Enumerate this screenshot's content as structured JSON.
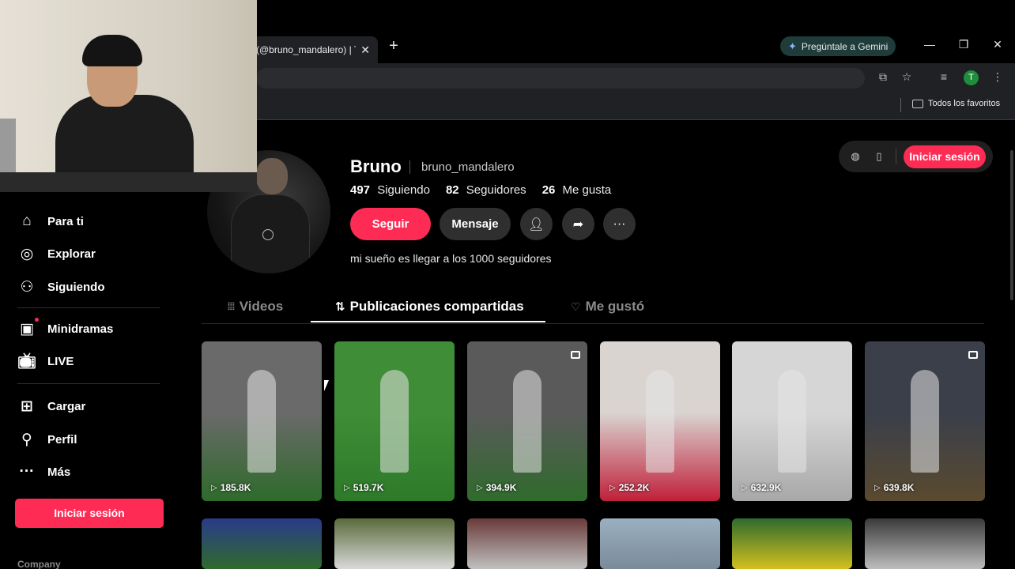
{
  "browser": {
    "tab_title": "(@bruno_mandalero) | Ti",
    "tab_close": "✕",
    "new_tab": "+",
    "gemini_label": "Pregúntale a Gemini",
    "profile_initial": "T",
    "bookmarks_label": "Todos los favoritos"
  },
  "sidebar": {
    "items": [
      {
        "label": "Para ti",
        "icon": "home-icon"
      },
      {
        "label": "Explorar",
        "icon": "compass-icon"
      },
      {
        "label": "Siguiendo",
        "icon": "following-icon"
      },
      {
        "label": "Minidramas",
        "icon": "minidrama-icon"
      },
      {
        "label": "LIVE",
        "icon": "live-icon"
      },
      {
        "label": "Cargar",
        "icon": "upload-icon"
      },
      {
        "label": "Perfil",
        "icon": "profile-icon"
      },
      {
        "label": "Más",
        "icon": "more-icon"
      }
    ],
    "login_label": "Iniciar sesión",
    "company_label": "Company"
  },
  "profile": {
    "display_name": "Bruno",
    "username": "bruno_mandalero",
    "following_count": "497",
    "following_label": "Siguiendo",
    "followers_count": "82",
    "followers_label": "Seguidores",
    "likes_count": "26",
    "likes_label": "Me gusta",
    "follow_label": "Seguir",
    "message_label": "Mensaje",
    "bio": "mi sueño es llegar a los 1000 seguidores"
  },
  "header_actions": {
    "login_label": "Iniciar sesión"
  },
  "tabs": [
    {
      "label": "Videos",
      "active": false
    },
    {
      "label": "Publicaciones compartidas",
      "active": true
    },
    {
      "label": "Me gustó",
      "active": false
    }
  ],
  "videos": [
    {
      "views": "185.8K",
      "multi": false,
      "colors": [
        "#6a6a6a",
        "#2e6b2a"
      ]
    },
    {
      "views": "519.7K",
      "multi": false,
      "colors": [
        "#3f8d36",
        "#2d7a2a"
      ]
    },
    {
      "views": "394.9K",
      "multi": true,
      "colors": [
        "#5a5a5a",
        "#2f6b2c"
      ]
    },
    {
      "views": "252.2K",
      "multi": false,
      "colors": [
        "#d9d4d0",
        "#c0203a"
      ]
    },
    {
      "views": "632.9K",
      "multi": false,
      "colors": [
        "#d6d6d6",
        "#a8a8a8"
      ]
    },
    {
      "views": "639.8K",
      "multi": true,
      "colors": [
        "#3a3f4a",
        "#5a4a2f"
      ]
    }
  ],
  "videos_row2": [
    {
      "colors": [
        "#2a3a8a",
        "#2f6b2c"
      ]
    },
    {
      "colors": [
        "#5a6a3a",
        "#d9d9d9"
      ]
    },
    {
      "colors": [
        "#6a3a3a",
        "#c0c0c0"
      ]
    },
    {
      "colors": [
        "#9ab0c0",
        "#7a8a9a"
      ]
    },
    {
      "colors": [
        "#2f6b2c",
        "#d4c020"
      ]
    },
    {
      "colors": [
        "#3a3a3a",
        "#bdbdbd"
      ]
    }
  ]
}
